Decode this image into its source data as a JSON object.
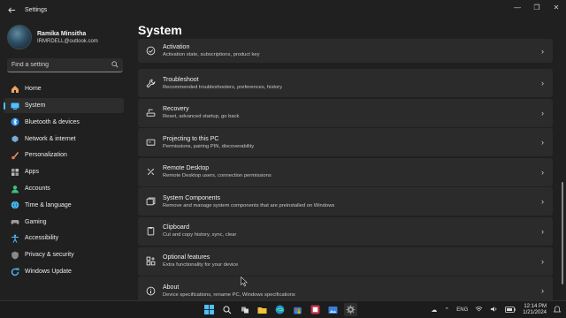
{
  "app": {
    "title": "Settings"
  },
  "profile": {
    "name": "Ramika Minsitha",
    "email": "IRMRDELL@outlook.com"
  },
  "search": {
    "placeholder": "Find a setting"
  },
  "nav": {
    "items": [
      {
        "label": "Home",
        "icon": "home-icon",
        "color": "#f0a35e"
      },
      {
        "label": "System",
        "icon": "system-icon",
        "color": "#4cc2ff"
      },
      {
        "label": "Bluetooth & devices",
        "icon": "bluetooth-icon",
        "color": "#2b8ce6"
      },
      {
        "label": "Network & internet",
        "icon": "network-icon",
        "color": "#7aa9d8"
      },
      {
        "label": "Personalization",
        "icon": "brush-icon",
        "color": "#f0a35e"
      },
      {
        "label": "Apps",
        "icon": "apps-icon",
        "color": "#9a9a9a"
      },
      {
        "label": "Accounts",
        "icon": "accounts-icon",
        "color": "#3fbf7f"
      },
      {
        "label": "Time & language",
        "icon": "globe-icon",
        "color": "#4cc2ff"
      },
      {
        "label": "Gaming",
        "icon": "gaming-icon",
        "color": "#9a9a9a"
      },
      {
        "label": "Accessibility",
        "icon": "accessibility-icon",
        "color": "#4cc2ff"
      },
      {
        "label": "Privacy & security",
        "icon": "shield-icon",
        "color": "#8a8a8a"
      },
      {
        "label": "Windows Update",
        "icon": "update-icon",
        "color": "#4cc2ff"
      }
    ],
    "active": "System"
  },
  "page": {
    "title": "System"
  },
  "cards": [
    {
      "title": "Activation",
      "desc": "Activation state, subscriptions, product key",
      "icon": "activation-icon"
    },
    {
      "title": "Troubleshoot",
      "desc": "Recommended troubleshooters, preferences, history",
      "icon": "wrench-icon"
    },
    {
      "title": "Recovery",
      "desc": "Reset, advanced startup, go back",
      "icon": "recovery-icon"
    },
    {
      "title": "Projecting to this PC",
      "desc": "Permissions, pairing PIN, discoverability",
      "icon": "projector-icon"
    },
    {
      "title": "Remote Desktop",
      "desc": "Remote Desktop users, connection permissions",
      "icon": "remote-desktop-icon"
    },
    {
      "title": "System Components",
      "desc": "Remove and manage system components that are preinstalled on Windows",
      "icon": "components-icon"
    },
    {
      "title": "Clipboard",
      "desc": "Cut and copy history, sync, clear",
      "icon": "clipboard-icon"
    },
    {
      "title": "Optional features",
      "desc": "Extra functionality for your device",
      "icon": "optional-features-icon"
    },
    {
      "title": "About",
      "desc": "Device specifications, rename PC, Windows specifications",
      "icon": "info-icon"
    }
  ],
  "taskbar": {
    "lang": "ENG",
    "time": "12:14 PM",
    "date": "1/21/2024"
  },
  "colors": {
    "accent": "#4cc2ff",
    "background": "#202020",
    "card": "#2b2b2b"
  }
}
